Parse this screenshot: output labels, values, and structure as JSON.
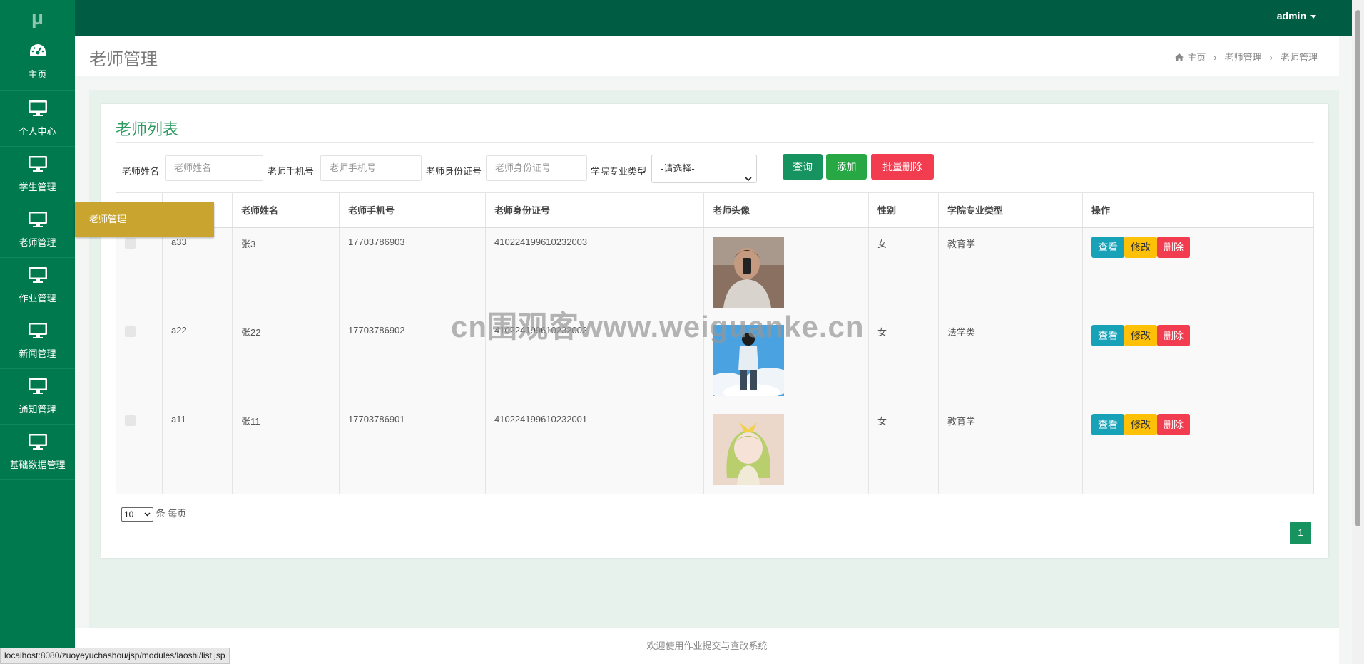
{
  "app": {
    "logo": "μ",
    "user": "admin"
  },
  "sidebar": {
    "items": [
      {
        "label": "主页",
        "icon": "dashboard-icon"
      },
      {
        "label": "个人中心",
        "icon": "monitor-icon"
      },
      {
        "label": "学生管理",
        "icon": "monitor-icon"
      },
      {
        "label": "老师管理",
        "icon": "monitor-icon"
      },
      {
        "label": "作业管理",
        "icon": "monitor-icon"
      },
      {
        "label": "新闻管理",
        "icon": "monitor-icon"
      },
      {
        "label": "通知管理",
        "icon": "monitor-icon"
      },
      {
        "label": "基础数据管理",
        "icon": "monitor-icon"
      }
    ],
    "flyout": "老师管理"
  },
  "page": {
    "title": "老师管理",
    "breadcrumb": [
      "主页",
      "老师管理",
      "老师管理"
    ]
  },
  "list": {
    "title": "老师列表",
    "search": {
      "name_label": "老师姓名",
      "name_placeholder": "老师姓名",
      "phone_label": "老师手机号",
      "phone_placeholder": "老师手机号",
      "id_label": "老师身份证号",
      "id_placeholder": "老师身份证号",
      "major_label": "学院专业类型",
      "major_value": "-请选择-",
      "query_btn": "查询",
      "add_btn": "添加",
      "batch_delete_btn": "批量删除"
    },
    "columns": [
      "",
      "",
      "老师姓名",
      "老师手机号",
      "老师身份证号",
      "老师头像",
      "性别",
      "学院专业类型",
      "操作"
    ],
    "rows": [
      {
        "account": "a33",
        "name": "张3",
        "phone": "17703786903",
        "idcard": "410224199610232003",
        "gender": "女",
        "major": "教育学"
      },
      {
        "account": "a22",
        "name": "张22",
        "phone": "17703786902",
        "idcard": "410224199610232002",
        "gender": "女",
        "major": "法学类"
      },
      {
        "account": "a11",
        "name": "张11",
        "phone": "17703786901",
        "idcard": "410224199610232001",
        "gender": "女",
        "major": "教育学"
      }
    ],
    "actions": {
      "view": "查看",
      "edit": "修改",
      "delete": "删除"
    },
    "pagination": {
      "page_size": "10",
      "per_page_text": "条 每页",
      "current_page": "1"
    }
  },
  "footer": "欢迎使用作业提交与查改系统",
  "status_url": "localhost:8080/zuoyeyuchashou/jsp/modules/laoshi/list.jsp",
  "watermark": "cn围观客www.weiguanke.cn",
  "colors": {
    "topbar": "#005d43",
    "sidebar": "#00794f",
    "flyout": "#c9a52f",
    "primary": "#17935f",
    "add": "#28a745",
    "danger": "#f23c4f",
    "info": "#17a2b8",
    "warning": "#ffc107"
  }
}
